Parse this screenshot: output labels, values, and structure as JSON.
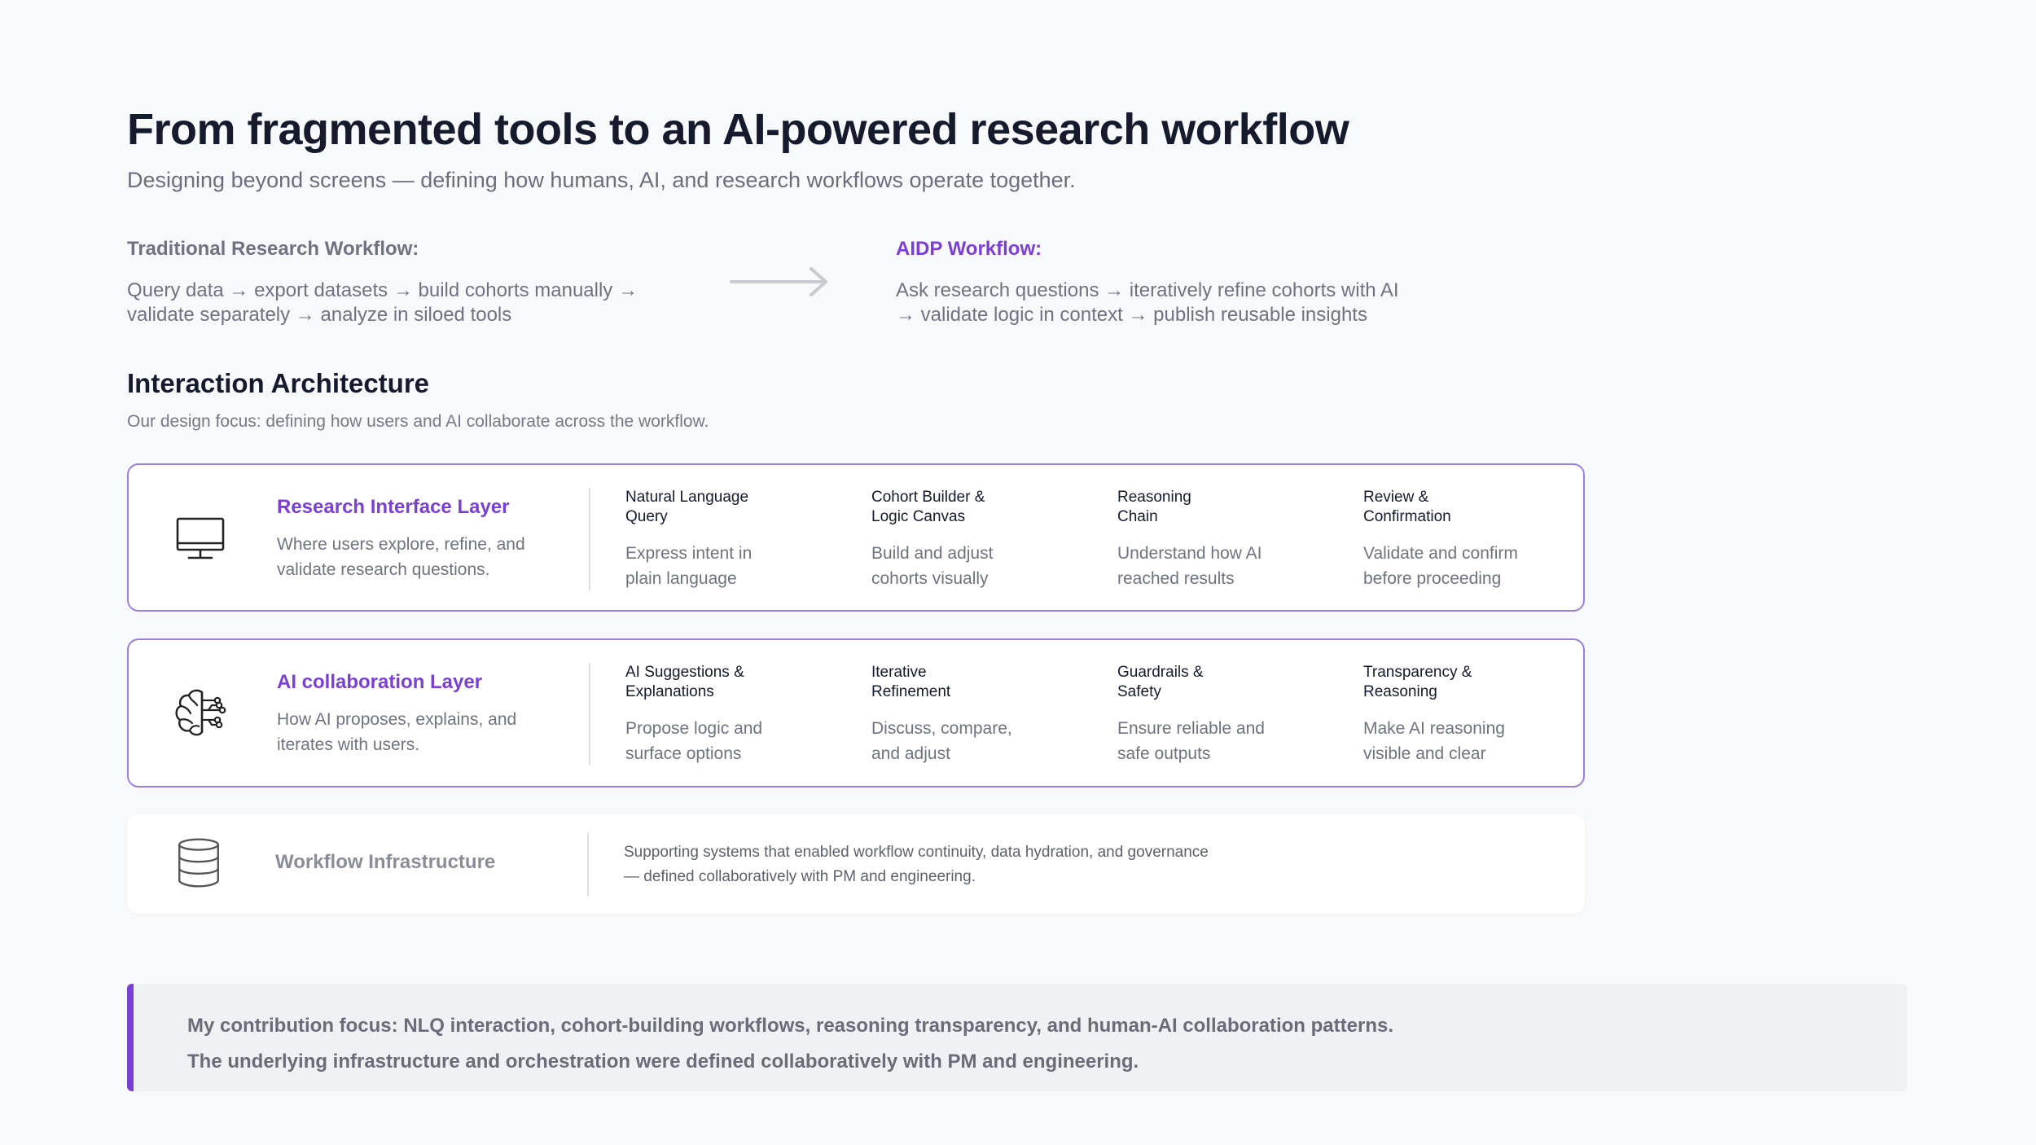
{
  "header": {
    "title": "From fragmented tools to an AI-powered research workflow",
    "subtitle": "Designing beyond screens — defining how humans, AI, and research workflows operate together."
  },
  "workflows": {
    "traditional": {
      "label": "Traditional Research Workflow:",
      "line1": "Query data → export datasets → build cohorts manually →",
      "line2": "validate separately → analyze in siloed tools"
    },
    "aidp": {
      "label": "AIDP Workflow:",
      "line1": "Ask research questions → iteratively refine cohorts with AI",
      "line2": "→ validate logic in context → publish reusable insights"
    },
    "arrow_icon": "right-arrow-icon"
  },
  "architecture": {
    "title": "Interaction Architecture",
    "subtitle": "Our design focus: defining how users and AI collaborate across the workflow.",
    "layers": [
      {
        "icon": "monitor-icon",
        "name": "Research Interface Layer",
        "desc_line1": "Where users explore, refine, and",
        "desc_line2": "validate research questions.",
        "capabilities": [
          {
            "title_line1": "Natural Language",
            "title_line2": "Query",
            "desc_line1": "Express intent in",
            "desc_line2": "plain language"
          },
          {
            "title_line1": "Cohort Builder &",
            "title_line2": "Logic Canvas",
            "desc_line1": "Build and adjust",
            "desc_line2": "cohorts visually"
          },
          {
            "title_line1": "Reasoning",
            "title_line2": "Chain",
            "desc_line1": "Understand how AI",
            "desc_line2": "reached results"
          },
          {
            "title_line1": "Review &",
            "title_line2": "Confirmation",
            "desc_line1": "Validate and confirm",
            "desc_line2": "before proceeding"
          }
        ]
      },
      {
        "icon": "ai-brain-icon",
        "name": "AI collaboration Layer",
        "desc_line1": "How AI proposes, explains, and",
        "desc_line2": "iterates with users.",
        "capabilities": [
          {
            "title_line1": "AI Suggestions &",
            "title_line2": "Explanations",
            "desc_line1": "Propose logic and",
            "desc_line2": "surface options"
          },
          {
            "title_line1": "Iterative",
            "title_line2": "Refinement",
            "desc_line1": "Discuss, compare,",
            "desc_line2": "and adjust"
          },
          {
            "title_line1": "Guardrails &",
            "title_line2": "Safety",
            "desc_line1": "Ensure reliable and",
            "desc_line2": "safe outputs"
          },
          {
            "title_line1": "Transparency &",
            "title_line2": "Reasoning",
            "desc_line1": "Make AI reasoning",
            "desc_line2": "visible and clear"
          }
        ]
      },
      {
        "icon": "database-icon",
        "name": "Workflow Infrastructure",
        "text_line1": "Supporting systems that enabled workflow continuity, data hydration, and governance",
        "text_line2": "— defined collaboratively with PM and engineering."
      }
    ]
  },
  "callout": {
    "line1": "My contribution focus: NLQ interaction, cohort-building workflows, reasoning transparency, and human-AI collaboration patterns.",
    "line2": "The underlying infrastructure and orchestration were defined collaboratively with PM and engineering."
  },
  "colors": {
    "accent": "#7b3fd6",
    "border": "#9a7fe0",
    "background": "#f8f9fb"
  }
}
